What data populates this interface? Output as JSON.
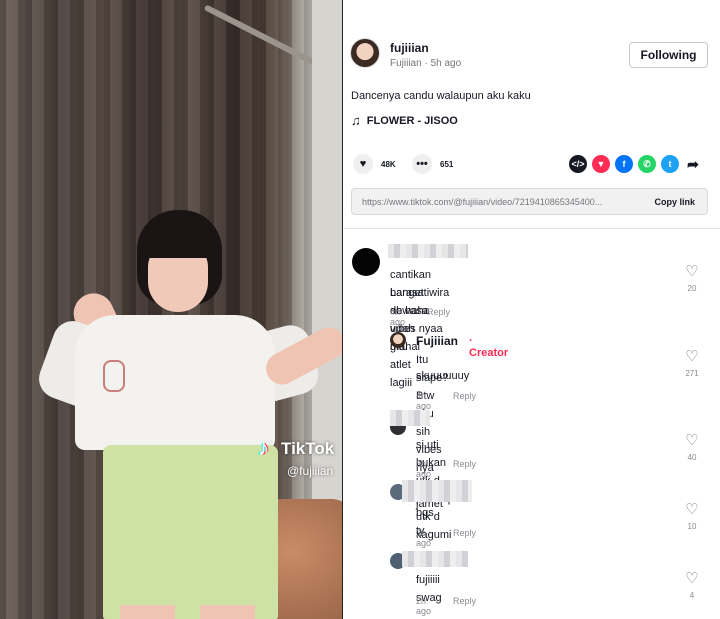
{
  "video": {
    "watermark_logo": "♪",
    "watermark_text": "TikTok",
    "watermark_user": "@fujiiian"
  },
  "author": {
    "name": "fujiiian",
    "meta": "Fujiiian · 5h ago",
    "follow_label": "Following"
  },
  "caption": "Dancenya candu walaupun aku kaku",
  "music": {
    "icon": "♫",
    "title": "FLOWER - JISOO"
  },
  "stats": {
    "likes": "48K",
    "comments": "651",
    "like_icon": "heart-icon",
    "comment_icon": "comment-icon"
  },
  "share": {
    "embed": "</>",
    "friends": "▼",
    "facebook": "f",
    "whatsapp": "✆",
    "twitter": "t",
    "more": "➦"
  },
  "link": {
    "url": "https://www.tiktok.com/@fujiiian/video/7219410865345400...",
    "copy_label": "Copy link"
  },
  "comments": [
    {
      "text_line1": "cantikan Larasatiwira ah haha vibes nyaa mahal",
      "text_line2": "banget dewasa udah gitu atlet lagiii",
      "time": "4h ago",
      "reply": "Reply",
      "likes": "20"
    },
    {
      "author": "Fujiiian",
      "tag": "Creator",
      "text_line1": "Itu siape? Btw aku sih vibes nya sih jamet",
      "text_line2": "skuuuuuuy",
      "time": "4h ago",
      "reply": "Reply",
      "likes": "271"
    },
    {
      "text_line1": "si uti bukan utk d pilih.tapi utk d kagumi",
      "time": "3h ago",
      "reply": "Reply",
      "likes": "40"
    },
    {
      "text_line1": "bgs ty",
      "time": "3h ago",
      "reply": "Reply",
      "likes": "10"
    },
    {
      "text_line1": "fujiiiii swag",
      "time": "2h ago",
      "reply": "Reply",
      "likes": "4"
    }
  ],
  "colors": {
    "accent": "#fe2c55",
    "text": "#161823",
    "muted": "#8a8b91"
  }
}
